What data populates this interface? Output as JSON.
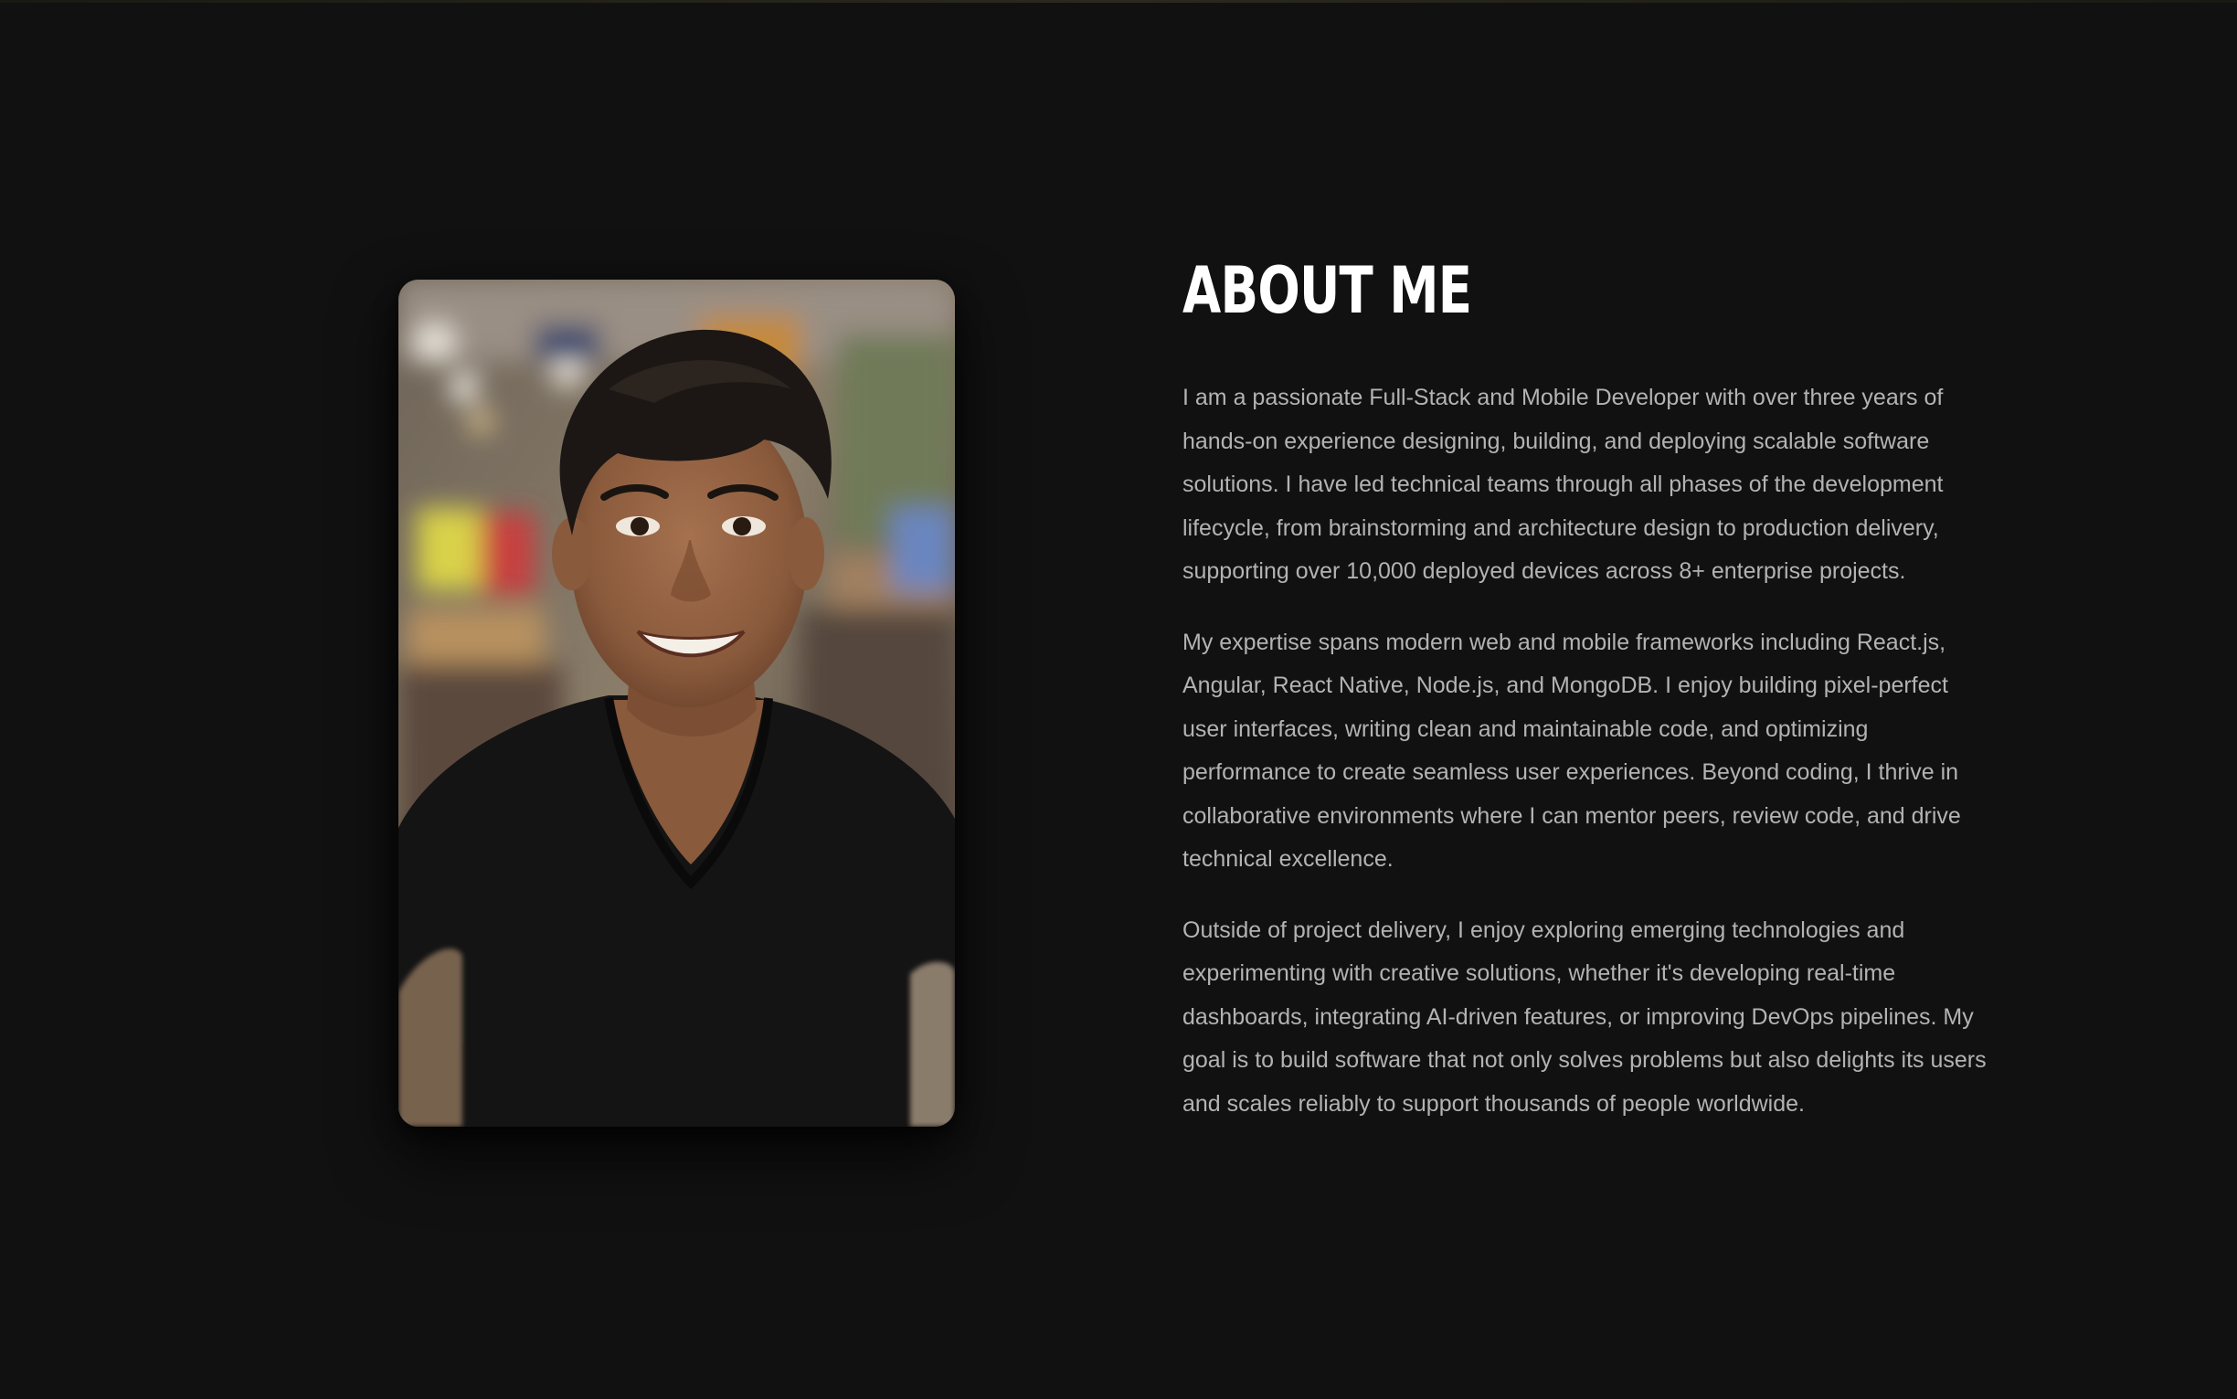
{
  "about": {
    "title": "ABOUT ME",
    "photo_alt": "portrait-photo",
    "paragraphs": [
      "I am a passionate Full-Stack and Mobile Developer with over three years of hands-on experience designing, building, and deploying scalable software solutions. I have led technical teams through all phases of the development lifecycle, from brainstorming and architecture design to production delivery, supporting over 10,000 deployed devices across 8+ enterprise projects.",
      "My expertise spans modern web and mobile frameworks including React.js, Angular, React Native, Node.js, and MongoDB. I enjoy building pixel-perfect user interfaces, writing clean and maintainable code, and optimizing performance to create seamless user experiences. Beyond coding, I thrive in collaborative environments where I can mentor peers, review code, and drive technical excellence.",
      "Outside of project delivery, I enjoy exploring emerging technologies and experimenting with creative solutions, whether it's developing real-time dashboards, integrating AI-driven features, or improving DevOps pipelines. My goal is to build software that not only solves problems but also delights its users and scales reliably to support thousands of people worldwide."
    ]
  },
  "colors": {
    "background": "#111111",
    "title": "#ffffff",
    "body_text": "#b3b3b3"
  }
}
